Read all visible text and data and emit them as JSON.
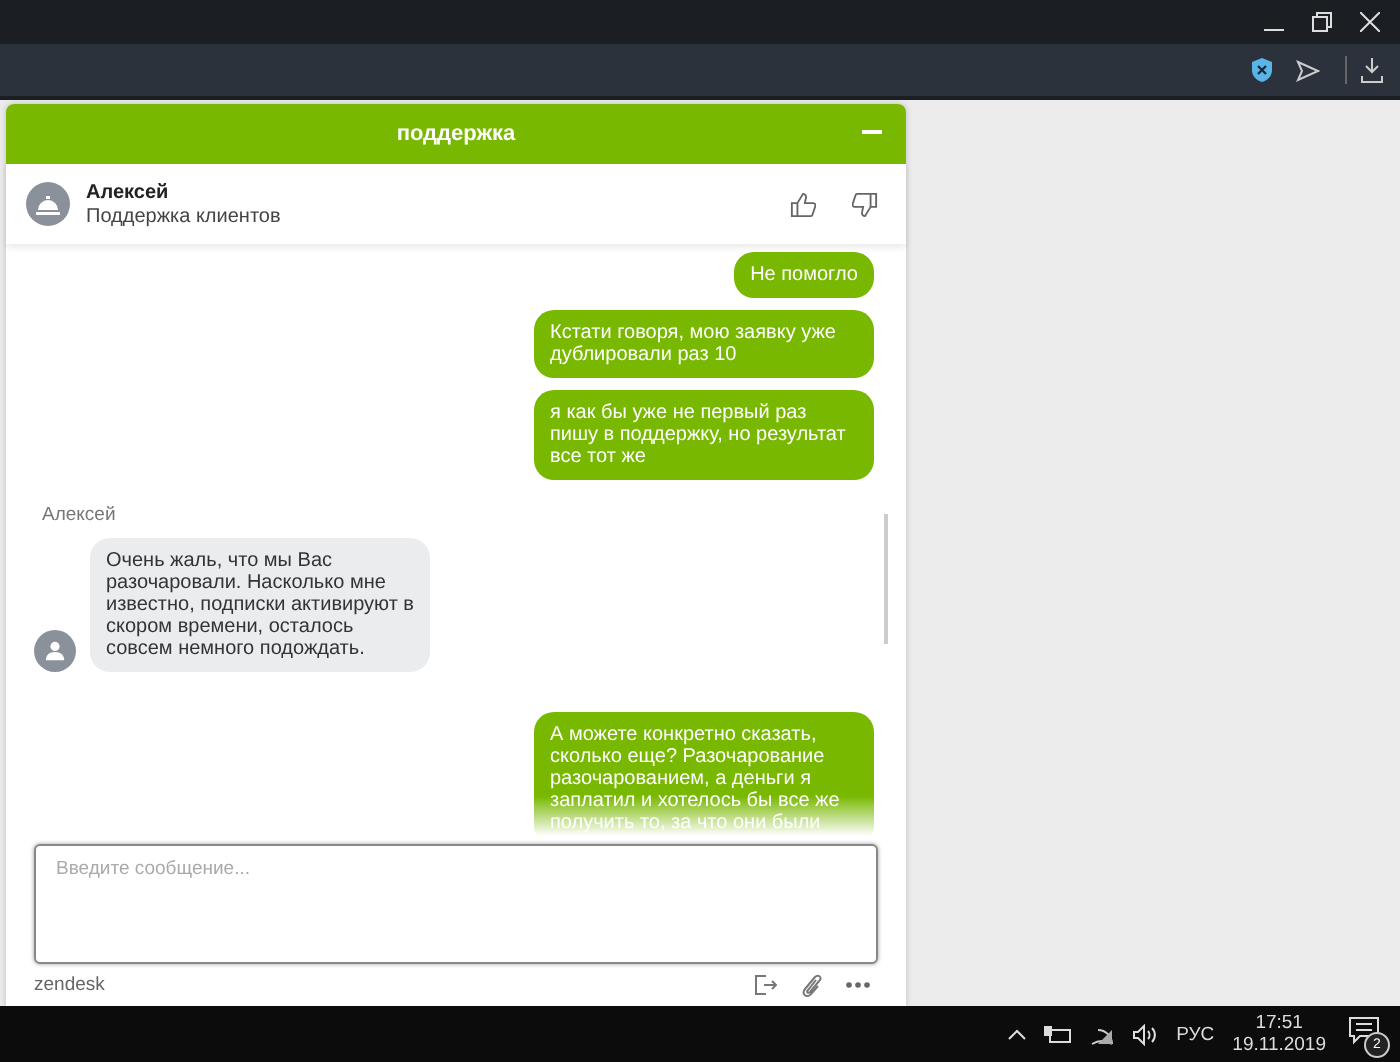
{
  "widget": {
    "title": "поддержка",
    "agent": {
      "name": "Алексей",
      "role": "Поддержка клиентов"
    },
    "messages": [
      {
        "kind": "visitor",
        "text": "Не помогло"
      },
      {
        "kind": "visitor",
        "text": "Кстати говоря, мою заявку уже дублировали раз 10"
      },
      {
        "kind": "visitor",
        "text": "я как бы уже не первый раз пишу в поддержку, но результат все тот же"
      },
      {
        "kind": "agent",
        "sender": "Алексей",
        "text": "Очень жаль, что мы Вас разочаровали. Насколько мне известно, подписки активируют в скором времени, осталось совсем немного подождать."
      },
      {
        "kind": "visitor",
        "text": "А можете конкретно сказать, сколько еще? Разочарование разочарованием, а деньги я заплатил и хотелось бы все же получить то, за что они были"
      }
    ],
    "input": {
      "placeholder": "Введите сообщение..."
    },
    "brand": "zendesk"
  },
  "taskbar": {
    "language": "РУС",
    "time": "17:51",
    "date": "19.11.2019",
    "notifications": "2"
  }
}
